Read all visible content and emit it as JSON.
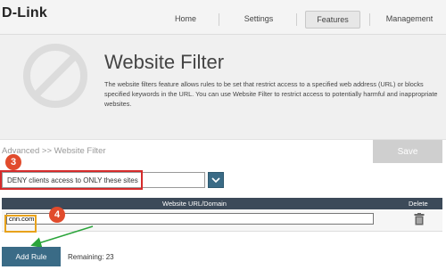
{
  "brand": {
    "logo": "D-Link"
  },
  "nav": {
    "items": [
      "Home",
      "Settings",
      "Features",
      "Management"
    ],
    "active": "Features"
  },
  "hero": {
    "title": "Website Filter",
    "description": "The website filters feature allows rules to be set that restrict access to a specified web address (URL) or blocks specified keywords in the URL. You can use Website Filter to restrict access to potentially harmful and inappropriate websites."
  },
  "breadcrumb": "Advanced >> Website Filter",
  "save_label": "Save",
  "filter_mode": {
    "selected": "DENY clients access to ONLY these sites"
  },
  "table": {
    "headers": {
      "url": "Website URL/Domain",
      "delete": "Delete"
    },
    "rows": [
      {
        "url": "cnn.com"
      }
    ]
  },
  "add_rule_label": "Add Rule",
  "remaining_text": "Remaining: 23",
  "annotations": {
    "step_a": "3",
    "step_b": "4"
  },
  "colors": {
    "accent": "#3a6b86",
    "header_bar": "#3c4a59",
    "annotation_red": "#d62b2b",
    "annotation_orange": "#e8a21b",
    "arrow_green": "#2aa43a"
  },
  "icons": {
    "hero": "block-icon",
    "dropdown": "chevron-down-icon",
    "delete": "trash-icon"
  }
}
